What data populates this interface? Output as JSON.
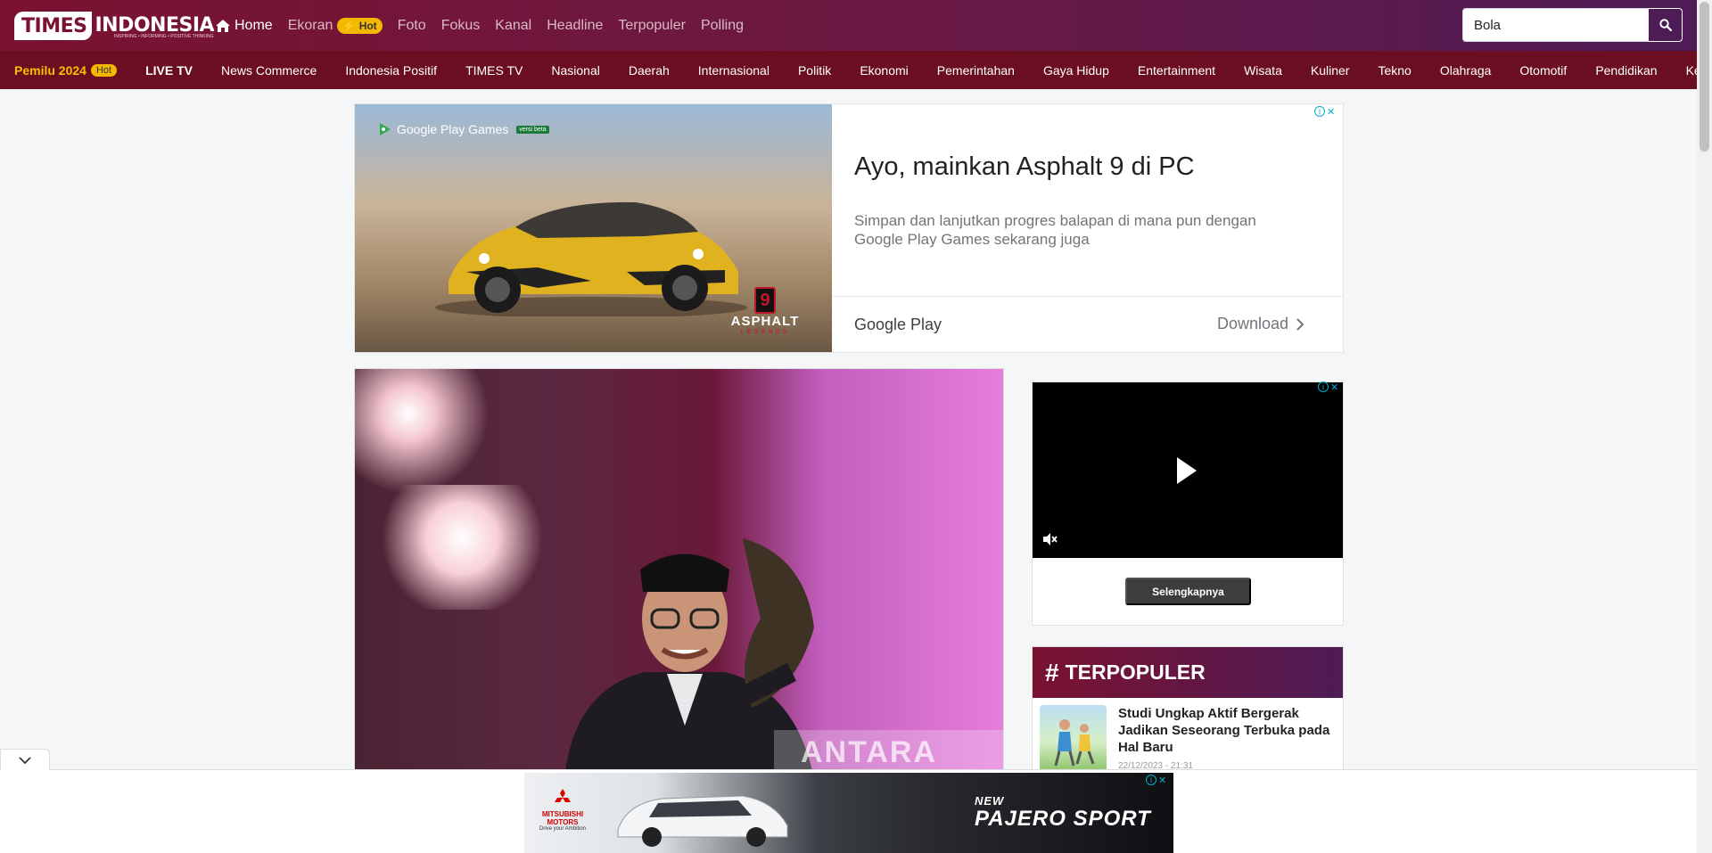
{
  "header": {
    "logo_times": "TIMES",
    "logo_indonesia": "INDONESIA",
    "logo_tagline": "INSPIRING • INFORMING • POSITIVE THINKING",
    "nav": [
      {
        "label": "Home",
        "active": true
      },
      {
        "label": "Ekoran",
        "badge": "Hot"
      },
      {
        "label": "Foto"
      },
      {
        "label": "Fokus"
      },
      {
        "label": "Kanal"
      },
      {
        "label": "Headline"
      },
      {
        "label": "Terpopuler"
      },
      {
        "label": "Polling"
      }
    ],
    "search_value": "Bola"
  },
  "categories": {
    "pemilu": "Pemilu 2024",
    "pemilu_badge": "Hot",
    "items": [
      "LIVE TV",
      "News Commerce",
      "Indonesia Positif",
      "TIMES TV",
      "Nasional",
      "Daerah",
      "Internasional",
      "Politik",
      "Ekonomi",
      "Pemerintahan",
      "Gaya Hidup",
      "Entertainment",
      "Wisata",
      "Kuliner",
      "Tekno",
      "Olahraga",
      "Otomotif",
      "Pendidikan",
      "Kesehatan"
    ]
  },
  "top_ad": {
    "brand": "Google Play Games",
    "beta": "versi beta",
    "game_number": "9",
    "game_name": "ASPHALT",
    "game_sub": "LEGENDS",
    "headline": "Ayo, mainkan Asphalt 9 di PC",
    "description": "Simpan dan lanjutkan progres balapan di mana pun dengan Google Play Games sekarang juga",
    "store": "Google Play",
    "cta": "Download"
  },
  "main_image": {
    "watermark": "ANTARA"
  },
  "video_ad": {
    "button": "Selengkapnya"
  },
  "popular": {
    "heading": "TERPOPULER",
    "items": [
      {
        "title": "Studi Ungkap Aktif Bergerak Jadikan Seseorang Terbuka pada Hal Baru",
        "date": "22/12/2023 - 21:31"
      }
    ]
  },
  "bottom_ad": {
    "brand": "MITSUBISHI MOTORS",
    "slogan": "Drive your Ambition",
    "model_prefix": "NEW",
    "model": "PAJERO SPORT"
  },
  "colors": {
    "brand": "#7a1230",
    "brand_dark": "#4d1b55",
    "category_bar": "#6b0e22",
    "hot": "#f5b800"
  }
}
